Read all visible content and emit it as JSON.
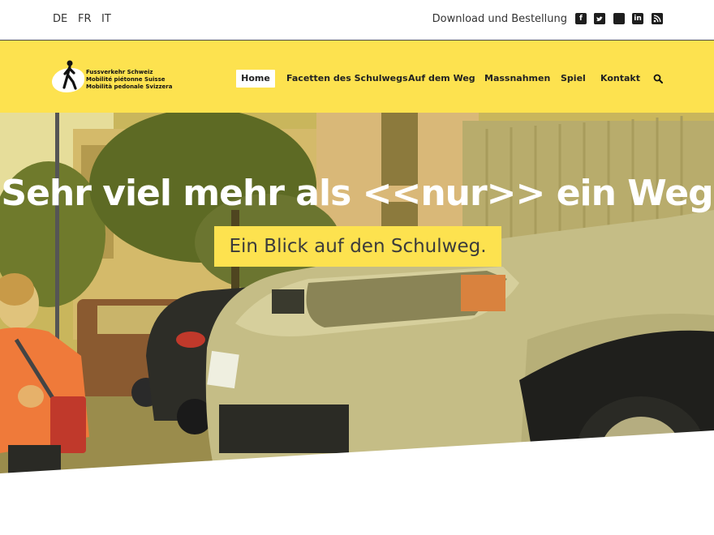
{
  "topbar": {
    "languages": [
      "DE",
      "FR",
      "IT"
    ],
    "download_link": "Download und Bestellung",
    "social_icons": [
      "facebook-icon",
      "twitter-icon",
      "instagram-icon",
      "linkedin-icon",
      "rss-icon"
    ]
  },
  "header": {
    "logo_lines": [
      "Fussverkehr Schweiz",
      "Mobilité piétonne Suisse",
      "Mobilità pedonale Svizzera"
    ],
    "nav": {
      "home": "Home",
      "facetten": "Facetten des Schulwegs",
      "weg": "Auf dem Weg",
      "massnahmen": "Massnahmen",
      "spiel": "Spiel",
      "kontakt": "Kontakt"
    },
    "active_nav": "Home"
  },
  "hero": {
    "title": "Sehr viel mehr als <<nur>> ein Weg",
    "subtitle": "Ein Blick auf den Schulweg."
  },
  "colors": {
    "accent_yellow": "#fde24f",
    "text_dark": "#222222",
    "hero_title": "#ffffff"
  }
}
